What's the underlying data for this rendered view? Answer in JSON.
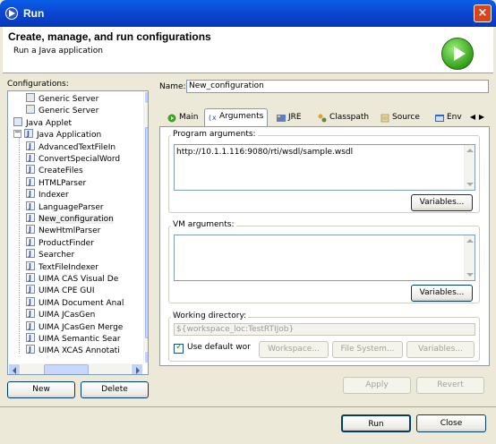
{
  "window": {
    "title": "Run"
  },
  "header": {
    "title": "Create, manage, and run configurations",
    "subtitle": "Run a Java application"
  },
  "left": {
    "label": "Configurations:",
    "tree": [
      {
        "label": "Generic Server",
        "level": 1,
        "icon": "server-icon"
      },
      {
        "label": "Generic Server",
        "level": 1,
        "icon": "server-icon"
      },
      {
        "label": "Java Applet",
        "level": 0,
        "icon": "applet-icon"
      },
      {
        "label": "Java Application",
        "level": 0,
        "icon": "java-app-icon",
        "expanded": true
      },
      {
        "label": "AdvancedTextFileIn",
        "level": 1,
        "icon": "java-class-icon"
      },
      {
        "label": "ConvertSpecialWord",
        "level": 1,
        "icon": "java-class-icon"
      },
      {
        "label": "CreateFiles",
        "level": 1,
        "icon": "java-class-icon"
      },
      {
        "label": "HTMLParser",
        "level": 1,
        "icon": "java-class-icon"
      },
      {
        "label": "Indexer",
        "level": 1,
        "icon": "java-class-icon"
      },
      {
        "label": "LanguageParser",
        "level": 1,
        "icon": "java-class-icon"
      },
      {
        "label": "New_configuration",
        "level": 1,
        "icon": "java-class-icon",
        "selected": true
      },
      {
        "label": "NewHtmlParser",
        "level": 1,
        "icon": "java-class-icon"
      },
      {
        "label": "ProductFinder",
        "level": 1,
        "icon": "java-class-icon"
      },
      {
        "label": "Searcher",
        "level": 1,
        "icon": "java-class-icon"
      },
      {
        "label": "TextFileIndexer",
        "level": 1,
        "icon": "java-class-icon"
      },
      {
        "label": "UIMA CAS Visual De",
        "level": 1,
        "icon": "java-class-icon"
      },
      {
        "label": "UIMA CPE GUI",
        "level": 1,
        "icon": "java-class-icon"
      },
      {
        "label": "UIMA Document Anal",
        "level": 1,
        "icon": "java-class-icon"
      },
      {
        "label": "UIMA JCasGen",
        "level": 1,
        "icon": "java-class-icon"
      },
      {
        "label": "UIMA JCasGen Merge",
        "level": 1,
        "icon": "java-class-icon"
      },
      {
        "label": "UIMA Semantic Sear",
        "level": 1,
        "icon": "java-class-icon"
      },
      {
        "label": "UIMA XCAS Annotati",
        "level": 1,
        "icon": "java-class-icon"
      }
    ],
    "new_label": "New",
    "delete_label": "Delete"
  },
  "right": {
    "name_label": "Name:",
    "name_value": "New_configuration",
    "tabs": [
      {
        "label": "Main",
        "icon": "main-tab-icon"
      },
      {
        "label": "Arguments",
        "icon": "arguments-tab-icon",
        "active": true
      },
      {
        "label": "JRE",
        "icon": "jre-tab-icon"
      },
      {
        "label": "Classpath",
        "icon": "classpath-tab-icon"
      },
      {
        "label": "Source",
        "icon": "source-tab-icon"
      },
      {
        "label": "Env",
        "icon": "environment-tab-icon"
      }
    ],
    "program_args_label": "Program arguments:",
    "program_args_value": "http://10.1.1.116:9080/rti/wsdl/sample.wsdl",
    "variables_label": "Variables...",
    "vm_args_label": "VM arguments:",
    "vm_args_value": "",
    "working_dir_label": "Working directory:",
    "working_dir_value": "${workspace_loc:TestRTIJob}",
    "use_default_label": "Use default wor",
    "use_default_checked": true,
    "workspace_label": "Workspace...",
    "filesystem_label": "File System...",
    "variables_disabled_label": "Variables...",
    "apply_label": "Apply",
    "revert_label": "Revert"
  },
  "footer": {
    "run_label": "Run",
    "close_label": "Close"
  }
}
